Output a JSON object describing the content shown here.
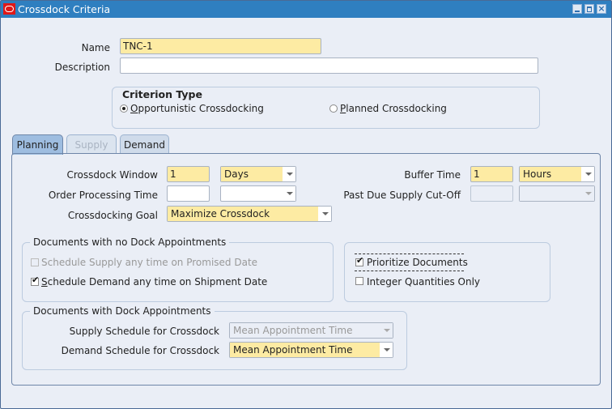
{
  "window": {
    "title": "Crossdock Criteria",
    "controls": {
      "minimize": "minimize",
      "maximize": "maximize",
      "close": "×"
    }
  },
  "header": {
    "name_label": "Name",
    "name_value": "TNC-1",
    "description_label": "Description",
    "description_value": ""
  },
  "criterion_type": {
    "title": "Criterion Type",
    "options": [
      {
        "label": "Opportunistic Crossdocking",
        "mnemonic": "O",
        "rest": "pportunistic Crossdocking",
        "selected": true
      },
      {
        "label": "Planned Crossdocking",
        "mnemonic": "P",
        "rest": "lanned Crossdocking",
        "selected": false
      }
    ]
  },
  "tabs": [
    {
      "label": "Planning",
      "active": true,
      "enabled": true
    },
    {
      "label": "Supply",
      "active": false,
      "enabled": false
    },
    {
      "label": "Demand",
      "active": false,
      "enabled": true
    }
  ],
  "planning": {
    "crossdock_window": {
      "label": "Crossdock Window",
      "value": "1",
      "unit": "Days"
    },
    "order_processing_time": {
      "label": "Order Processing Time",
      "value": "",
      "unit": ""
    },
    "crossdocking_goal": {
      "label": "Crossdocking Goal",
      "value": "Maximize Crossdock"
    },
    "buffer_time": {
      "label": "Buffer Time",
      "value": "1",
      "unit": "Hours"
    },
    "past_due_supply_cutoff": {
      "label": "Past Due Supply Cut-Off",
      "value": "",
      "unit": ""
    },
    "no_dock_appointments": {
      "title": "Documents with no Dock Appointments",
      "options": [
        {
          "label": "Schedule Supply any time on Promised Date",
          "checked": false,
          "enabled": false
        },
        {
          "label": "Schedule Demand any time on Shipment Date",
          "mnemonic": "S",
          "rest": "chedule Demand any time on Shipment Date",
          "checked": true,
          "enabled": true
        }
      ]
    },
    "other_options": [
      {
        "label": "Prioritize Documents",
        "checked": true,
        "focused": true
      },
      {
        "label": "Integer Quantities Only",
        "checked": false
      }
    ],
    "dock_appointments": {
      "title": "Documents with Dock Appointments",
      "supply_schedule": {
        "label": "Supply Schedule for Crossdock",
        "value": "Mean Appointment Time",
        "enabled": false
      },
      "demand_schedule": {
        "label": "Demand Schedule for Crossdock",
        "value": "Mean Appointment Time",
        "enabled": true
      }
    }
  }
}
